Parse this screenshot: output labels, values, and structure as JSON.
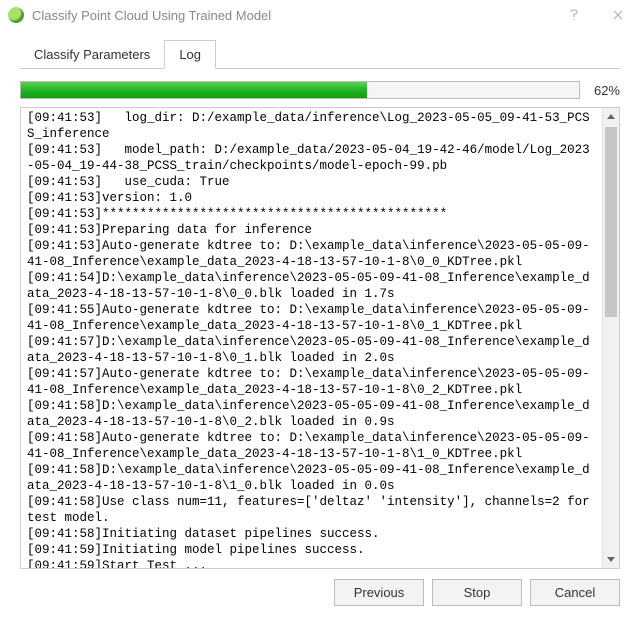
{
  "window": {
    "title": "Classify Point Cloud Using Trained Model"
  },
  "tabs": {
    "classify": "Classify Parameters",
    "log": "Log",
    "active": "log"
  },
  "progress": {
    "percent_display": "62%",
    "percent_value": 62
  },
  "log": {
    "lines": [
      "[09:41:53]   log_dir: D:/example_data/inference\\Log_2023-05-05_09-41-53_PCSS_inference",
      "[09:41:53]   model_path: D:/example_data/2023-05-04_19-42-46/model/Log_2023-05-04_19-44-38_PCSS_train/checkpoints/model-epoch-99.pb",
      "[09:41:53]   use_cuda: True",
      "[09:41:53]version: 1.0",
      "[09:41:53]**********************************************",
      "[09:41:53]Preparing data for inference",
      "[09:41:53]Auto-generate kdtree to: D:\\example_data\\inference\\2023-05-05-09-41-08_Inference\\example_data_2023-4-18-13-57-10-1-8\\0_0_KDTree.pkl",
      "[09:41:54]D:\\example_data\\inference\\2023-05-05-09-41-08_Inference\\example_data_2023-4-18-13-57-10-1-8\\0_0.blk loaded in 1.7s",
      "[09:41:55]Auto-generate kdtree to: D:\\example_data\\inference\\2023-05-05-09-41-08_Inference\\example_data_2023-4-18-13-57-10-1-8\\0_1_KDTree.pkl",
      "[09:41:57]D:\\example_data\\inference\\2023-05-05-09-41-08_Inference\\example_data_2023-4-18-13-57-10-1-8\\0_1.blk loaded in 2.0s",
      "[09:41:57]Auto-generate kdtree to: D:\\example_data\\inference\\2023-05-05-09-41-08_Inference\\example_data_2023-4-18-13-57-10-1-8\\0_2_KDTree.pkl",
      "[09:41:58]D:\\example_data\\inference\\2023-05-05-09-41-08_Inference\\example_data_2023-4-18-13-57-10-1-8\\0_2.blk loaded in 0.9s",
      "[09:41:58]Auto-generate kdtree to: D:\\example_data\\inference\\2023-05-05-09-41-08_Inference\\example_data_2023-4-18-13-57-10-1-8\\1_0_KDTree.pkl",
      "[09:41:58]D:\\example_data\\inference\\2023-05-05-09-41-08_Inference\\example_data_2023-4-18-13-57-10-1-8\\1_0.blk loaded in 0.0s",
      "[09:41:58]Use class num=11, features=['deltaz' 'intensity'], channels=2 for test model.",
      "[09:41:58]Initiating dataset pipelines success.",
      "[09:41:59]Initiating model pipelines success.",
      "[09:41:59]Start Test ..."
    ]
  },
  "buttons": {
    "previous": "Previous",
    "stop": "Stop",
    "cancel": "Cancel"
  }
}
